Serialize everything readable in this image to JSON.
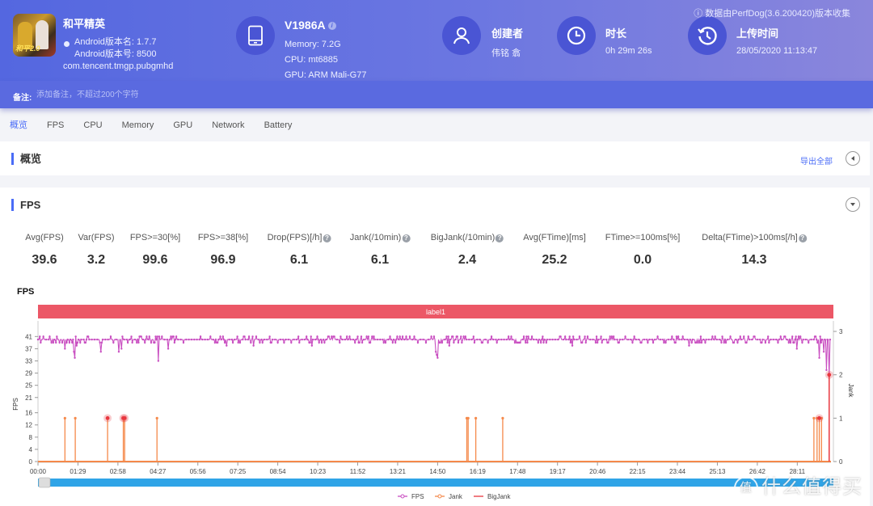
{
  "header": {
    "app_name": "和平精英",
    "android_version_name": "Android版本名: 1.7.7",
    "android_version_code": "Android版本号: 8500",
    "package": "com.tencent.tmgp.pubgmhd",
    "device": {
      "name": "V1986A",
      "memory": "Memory: 7.2G",
      "cpu": "CPU: mt6885",
      "gpu": "GPU: ARM Mali-G77"
    },
    "creator": {
      "title": "创建者",
      "value": "伟铭 翕"
    },
    "duration": {
      "title": "时长",
      "value": "0h 29m 26s"
    },
    "upload": {
      "title": "上传时间",
      "value": "28/05/2020 11:13:47"
    },
    "collected_by": "ⓘ 数据由PerfDog(3.6.200420)版本收集",
    "note_label": "备注:",
    "note_placeholder": "添加备注，不超过200个字符"
  },
  "tabs": [
    {
      "label": "概览",
      "active": true
    },
    {
      "label": "FPS"
    },
    {
      "label": "CPU"
    },
    {
      "label": "Memory"
    },
    {
      "label": "GPU"
    },
    {
      "label": "Network"
    },
    {
      "label": "Battery"
    }
  ],
  "overview": {
    "title": "概览",
    "export_label": "导出全部"
  },
  "fps_section": {
    "title": "FPS",
    "metrics": [
      {
        "label": "Avg(FPS)",
        "value": "39.6",
        "help": false
      },
      {
        "label": "Var(FPS)",
        "value": "3.2",
        "help": false
      },
      {
        "label": "FPS>=30[%]",
        "value": "99.6",
        "help": false
      },
      {
        "label": "FPS>=38[%]",
        "value": "96.9",
        "help": false
      },
      {
        "label": "Drop(FPS)[/h]",
        "value": "6.1",
        "help": true
      },
      {
        "label": "Jank(/10min)",
        "value": "6.1",
        "help": true
      },
      {
        "label": "BigJank(/10min)",
        "value": "2.4",
        "help": true
      },
      {
        "label": "Avg(FTime)[ms]",
        "value": "25.2",
        "help": false
      },
      {
        "label": "FTime>=100ms[%]",
        "value": "0.0",
        "help": false
      },
      {
        "label": "Delta(FTime)>100ms[/h]",
        "value": "14.3",
        "help": true
      }
    ]
  },
  "chart_data": {
    "type": "line",
    "title": "FPS",
    "label_band": "label1",
    "xlabel": "",
    "ylabel": "FPS",
    "y2label": "Jank",
    "x_ticks": [
      "00:00",
      "01:29",
      "02:58",
      "04:27",
      "05:56",
      "07:25",
      "08:54",
      "10:23",
      "11:52",
      "13:21",
      "14:50",
      "16:19",
      "17:48",
      "19:17",
      "20:46",
      "22:15",
      "23:44",
      "25:13",
      "26:42",
      "28:11"
    ],
    "y_ticks": [
      0,
      4,
      8,
      12,
      16,
      21,
      25,
      29,
      33,
      37,
      41
    ],
    "y2_ticks": [
      0,
      1,
      2,
      3
    ],
    "ylim": [
      0,
      44
    ],
    "y2lim": [
      0,
      3
    ],
    "duration_seconds": 1766,
    "fps_baseline": 40,
    "fps_dips": [
      {
        "t": 60,
        "v": 37
      },
      {
        "t": 80,
        "v": 36
      },
      {
        "t": 82,
        "v": 34
      },
      {
        "t": 86,
        "v": 38
      },
      {
        "t": 140,
        "v": 36
      },
      {
        "t": 180,
        "v": 36
      },
      {
        "t": 185,
        "v": 37
      },
      {
        "t": 268,
        "v": 33
      },
      {
        "t": 290,
        "v": 37
      },
      {
        "t": 420,
        "v": 38
      },
      {
        "t": 480,
        "v": 38
      },
      {
        "t": 610,
        "v": 38
      },
      {
        "t": 885,
        "v": 36
      },
      {
        "t": 888,
        "v": 35
      },
      {
        "t": 890,
        "v": 34
      },
      {
        "t": 915,
        "v": 38
      },
      {
        "t": 1190,
        "v": 38
      },
      {
        "t": 1450,
        "v": 38
      },
      {
        "t": 1690,
        "v": 37
      },
      {
        "t": 1740,
        "v": 34
      },
      {
        "t": 1750,
        "v": 36
      },
      {
        "t": 1755,
        "v": 30
      },
      {
        "t": 1762,
        "v": 28
      }
    ],
    "series": [
      {
        "name": "FPS",
        "color": "#c94fc1",
        "axis": "left"
      },
      {
        "name": "Jank",
        "color": "#f5894a",
        "axis": "right",
        "events": [
          {
            "t": 60,
            "v": 1
          },
          {
            "t": 83,
            "v": 1
          },
          {
            "t": 155,
            "v": 1
          },
          {
            "t": 190,
            "v": 1
          },
          {
            "t": 193,
            "v": 1
          },
          {
            "t": 265,
            "v": 1
          },
          {
            "t": 955,
            "v": 1
          },
          {
            "t": 958,
            "v": 1
          },
          {
            "t": 975,
            "v": 1
          },
          {
            "t": 1035,
            "v": 1
          },
          {
            "t": 1728,
            "v": 1
          },
          {
            "t": 1735,
            "v": 1
          },
          {
            "t": 1740,
            "v": 1
          },
          {
            "t": 1745,
            "v": 1
          }
        ]
      },
      {
        "name": "BigJank",
        "color": "#e8373f",
        "axis": "right",
        "events": [
          {
            "t": 155,
            "v": 1
          },
          {
            "t": 190,
            "v": 1
          },
          {
            "t": 193,
            "v": 1
          },
          {
            "t": 1740,
            "v": 1
          },
          {
            "t": 1762,
            "v": 2
          }
        ]
      }
    ],
    "legend": [
      "FPS",
      "Jank",
      "BigJank"
    ],
    "legend_position": "bottom-center"
  },
  "watermark": {
    "circle": "值",
    "text": "什么值得买"
  }
}
